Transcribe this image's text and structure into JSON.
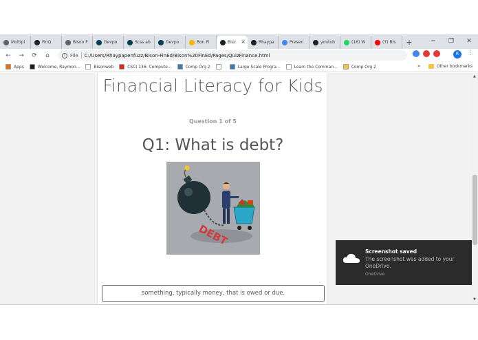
{
  "browser": {
    "tabs": [
      {
        "label": "Multipl",
        "favicon": "document-icon",
        "color": "#5f6368"
      },
      {
        "label": "FinQ",
        "favicon": "bison-icon",
        "color": "#202124"
      },
      {
        "label": "Bison F",
        "favicon": "document-icon",
        "color": "#5f6368"
      },
      {
        "label": "Devpo",
        "favicon": "devpost-icon",
        "color": "#003e54"
      },
      {
        "label": "Scss ab",
        "favicon": "devpost-icon",
        "color": "#003e54"
      },
      {
        "label": "Devpo",
        "favicon": "devpost-icon",
        "color": "#003e54"
      },
      {
        "label": "Bon Fi",
        "favicon": "slides-icon",
        "color": "#f4b400"
      },
      {
        "label": "Bisc",
        "favicon": "bison-icon",
        "color": "#202124",
        "active": true
      },
      {
        "label": "Rhaypa",
        "favicon": "github-icon",
        "color": "#202124"
      },
      {
        "label": "Presen",
        "favicon": "docs-icon",
        "color": "#4285f4"
      },
      {
        "label": "youtub",
        "favicon": "bison-icon",
        "color": "#202124"
      },
      {
        "label": "(16) W",
        "favicon": "whatsapp-icon",
        "color": "#25d366"
      },
      {
        "label": "(7) Bis",
        "favicon": "youtube-icon",
        "color": "#ff0000"
      }
    ],
    "tab_close": "×",
    "new_tab": "+",
    "window_controls": {
      "minimize": "─",
      "restore": "❐",
      "close": "✕"
    },
    "nav": {
      "back": "←",
      "forward": "→",
      "reload": "⟳",
      "home": "⌂"
    },
    "address": {
      "scheme_label": "File",
      "info": "i",
      "url": "C:/Users/Rhaypapenfuzz/Bison-FinEd/Bison%20FinEd/Pages/QuizFinance.html"
    },
    "star": "☆",
    "extensions": [
      {
        "name": "translate-icon",
        "color": "#4285f4"
      },
      {
        "name": "adblock-icon",
        "color": "#e53935"
      },
      {
        "name": "stop-icon",
        "color": "#e53935"
      }
    ],
    "avatar_letter": "R",
    "menu": "⋮",
    "bookmarks": [
      {
        "label": "Apps",
        "icon": "apps-icon",
        "color": "#e8710a"
      },
      {
        "label": "Welcome, Raymon...",
        "icon": "bm-icon",
        "color": "#202124"
      },
      {
        "label": "Bisonweb",
        "icon": "document-icon",
        "color": "#ffffff"
      },
      {
        "label": "CSCI 136: Compute...",
        "icon": "zybooks-icon",
        "color": "#e2231a"
      },
      {
        "label": "Comp Org 2",
        "icon": "piazza-icon",
        "color": "#3e7aab"
      },
      {
        "label": "",
        "icon": "document-icon",
        "color": "#ffffff"
      },
      {
        "label": "Large Scale Progra...",
        "icon": "piazza-icon",
        "color": "#3e7aab"
      },
      {
        "label": "Learn the Comman...",
        "icon": "terminal-icon",
        "color": "#ffffff"
      },
      {
        "label": "Comp Org 2",
        "icon": "folder-icon",
        "color": "#f6c344"
      }
    ],
    "bookmarks_overflow": "»",
    "other_bookmarks": "Other bookmarks"
  },
  "page": {
    "title": "Financial Literacy for Kids",
    "question_count": "Question 1 of 5",
    "question": "Q1: What is debt?",
    "illustration_label": "DEBT",
    "answer": "something, typically money, that is owed or due."
  },
  "toast": {
    "title": "Screenshot saved",
    "body": "The screenshot was added to your OneDrive.",
    "source": "OneDrive"
  },
  "colors": {
    "tab_strip": "#dee1e6",
    "page_bg": "#f2f2f2",
    "toast_bg": "#2b2b2b",
    "illustration_bg": "#a7abaf"
  }
}
